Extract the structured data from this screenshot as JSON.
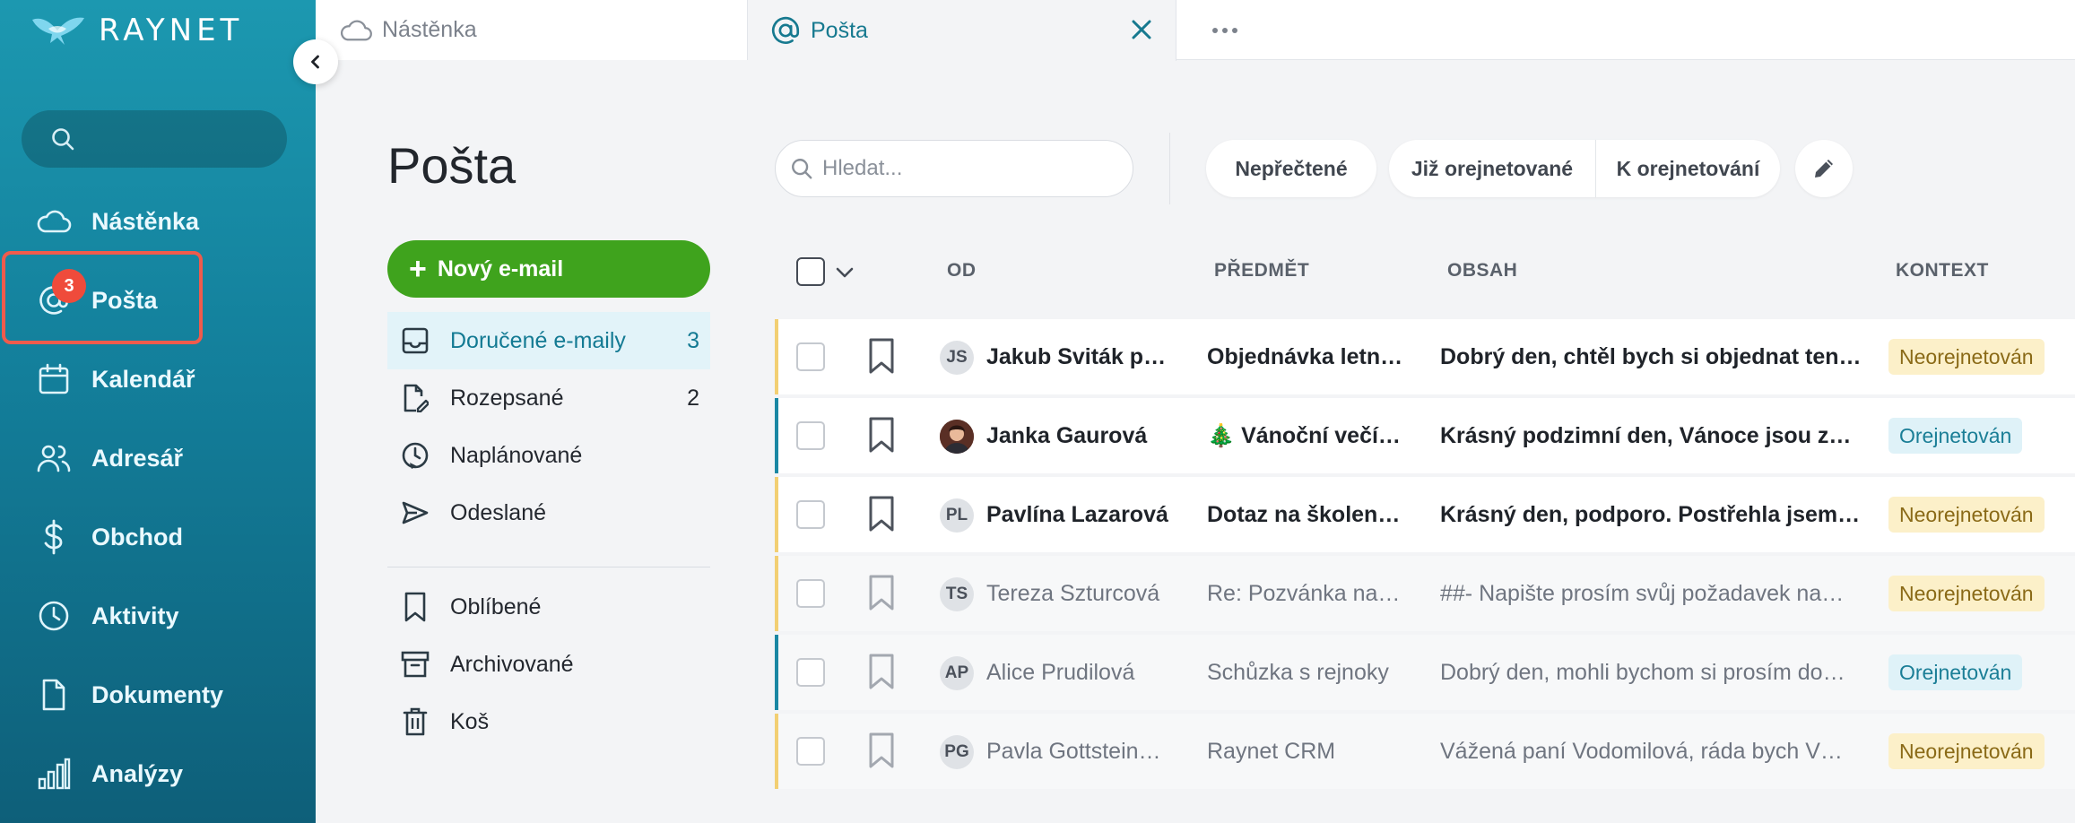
{
  "app": {
    "logo_text": "RAYNET"
  },
  "sidebar": {
    "mail_badge": "3",
    "items": [
      {
        "label": "Nástěnka",
        "icon": "cloud-icon"
      },
      {
        "label": "Pošta",
        "icon": "at-icon"
      },
      {
        "label": "Kalendář",
        "icon": "calendar-icon"
      },
      {
        "label": "Adresář",
        "icon": "people-icon"
      },
      {
        "label": "Obchod",
        "icon": "dollar-icon"
      },
      {
        "label": "Aktivity",
        "icon": "clock-icon"
      },
      {
        "label": "Dokumenty",
        "icon": "document-icon"
      },
      {
        "label": "Analýzy",
        "icon": "bar-chart-icon"
      }
    ]
  },
  "tabs": [
    {
      "label": "Nástěnka",
      "icon": "cloud-icon"
    },
    {
      "label": "Pošta",
      "icon": "at-icon"
    }
  ],
  "page": {
    "title": "Pošta",
    "new_email_label": "Nový e-mail"
  },
  "folders": [
    {
      "label": "Doručené e-maily",
      "count": "3",
      "icon": "inbox-icon"
    },
    {
      "label": "Rozepsané",
      "count": "2",
      "icon": "draft-icon"
    },
    {
      "label": "Naplánované",
      "count": "",
      "icon": "scheduled-icon"
    },
    {
      "label": "Odeslané",
      "count": "",
      "icon": "send-icon"
    }
  ],
  "folders2": [
    {
      "label": "Oblíbené",
      "icon": "bookmark-icon"
    },
    {
      "label": "Archivované",
      "icon": "archive-icon"
    },
    {
      "label": "Koš",
      "icon": "trash-icon"
    }
  ],
  "toolbar": {
    "search_placeholder": "Hledat...",
    "filter_unread": "Nepřečtené",
    "filter_done": "Již orejnetované",
    "filter_todo": "K orejnetování"
  },
  "table": {
    "headers": {
      "from": "OD",
      "subject": "PŘEDMĚT",
      "content": "OBSAH",
      "context": "KONTEXT"
    },
    "rows": [
      {
        "initials": "JS",
        "from": "Jakub Sviták po…",
        "subject": "Objednávka letní…",
        "content": "Dobrý den, chtěl bych si objednat ten l…",
        "context": "Neorejnetován",
        "unread": true
      },
      {
        "initials": "",
        "from": "Janka Gaurová",
        "subject": "🎄 Vánoční večír…",
        "content": "Krásný podzimní den, Vánoce jsou za …",
        "context": "Orejnetován",
        "unread": true
      },
      {
        "initials": "PL",
        "from": "Pavlína Lazarová",
        "subject": "Dotaz na školení …",
        "content": "Krásný den, podporo. Postřehla jsem, …",
        "context": "Neorejnetován",
        "unread": true
      },
      {
        "initials": "TS",
        "from": "Tereza Szturcová",
        "subject": "Re: Pozvánka na …",
        "content": "##- Napište prosím svůj požadavek na…",
        "context": "Neorejnetován",
        "unread": false
      },
      {
        "initials": "AP",
        "from": "Alice Prudilová",
        "subject": "Schůzka s rejnoky",
        "content": "Dobrý den, mohli bychom si prosím do…",
        "context": "Orejnetován",
        "unread": false
      },
      {
        "initials": "PG",
        "from": "Pavla Gottstein…",
        "subject": "Raynet CRM",
        "content": "Vážená paní Vodomilová, ráda bych V…",
        "context": "Neorejnetován",
        "unread": false
      }
    ]
  },
  "colors": {
    "accent": "#16798f",
    "primary_button": "#3fa31d",
    "badge": "#ef4b3b",
    "accent_unrated": "#f2cf73",
    "accent_rated": "#1a87a3"
  }
}
